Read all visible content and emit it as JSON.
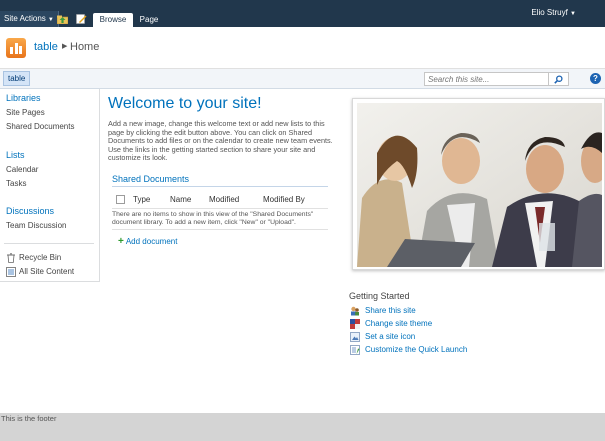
{
  "ribbon": {
    "site_actions": "Site Actions",
    "tabs": [
      {
        "label": "Browse"
      },
      {
        "label": "Page"
      }
    ],
    "user": "Elio Struyf"
  },
  "title_bar": {
    "site_title": "table",
    "page_title": "Home"
  },
  "top_nav": {
    "items": [
      {
        "label": "table"
      }
    ],
    "search_placeholder": "Search this site..."
  },
  "left_nav": {
    "sections": [
      {
        "heading": "Libraries",
        "items": [
          "Site Pages",
          "Shared Documents"
        ]
      },
      {
        "heading": "Lists",
        "items": [
          "Calendar",
          "Tasks"
        ]
      },
      {
        "heading": "Discussions",
        "items": [
          "Team Discussion"
        ]
      }
    ],
    "recycle_bin": "Recycle Bin",
    "all_site_content": "All Site Content"
  },
  "main": {
    "welcome_title": "Welcome to your site!",
    "welcome_text": "Add a new image, change this welcome text or add new lists to this page by clicking the edit button above. You can click on Shared Documents to add files or on the calendar to create new team events. Use the links in the getting started section to share your site and customize its look.",
    "docs": {
      "title": "Shared Documents",
      "columns": [
        "Type",
        "Name",
        "Modified",
        "Modified By"
      ],
      "empty_text": "There are no items to show in this view of the \"Shared Documents\" document library. To add a new item, click \"New\" or \"Upload\".",
      "add_label": "Add document"
    }
  },
  "getting_started": {
    "title": "Getting Started",
    "items": [
      {
        "label": "Share this site",
        "icon": "share-icon"
      },
      {
        "label": "Change site theme",
        "icon": "theme-icon"
      },
      {
        "label": "Set a site icon",
        "icon": "site-icon"
      },
      {
        "label": "Customize the Quick Launch",
        "icon": "quick-launch-icon"
      }
    ]
  },
  "footer": {
    "text": "This is the footer"
  },
  "colors": {
    "ribbon": "#21374c",
    "link": "#0072bc",
    "footer": "#d4d4d4"
  }
}
